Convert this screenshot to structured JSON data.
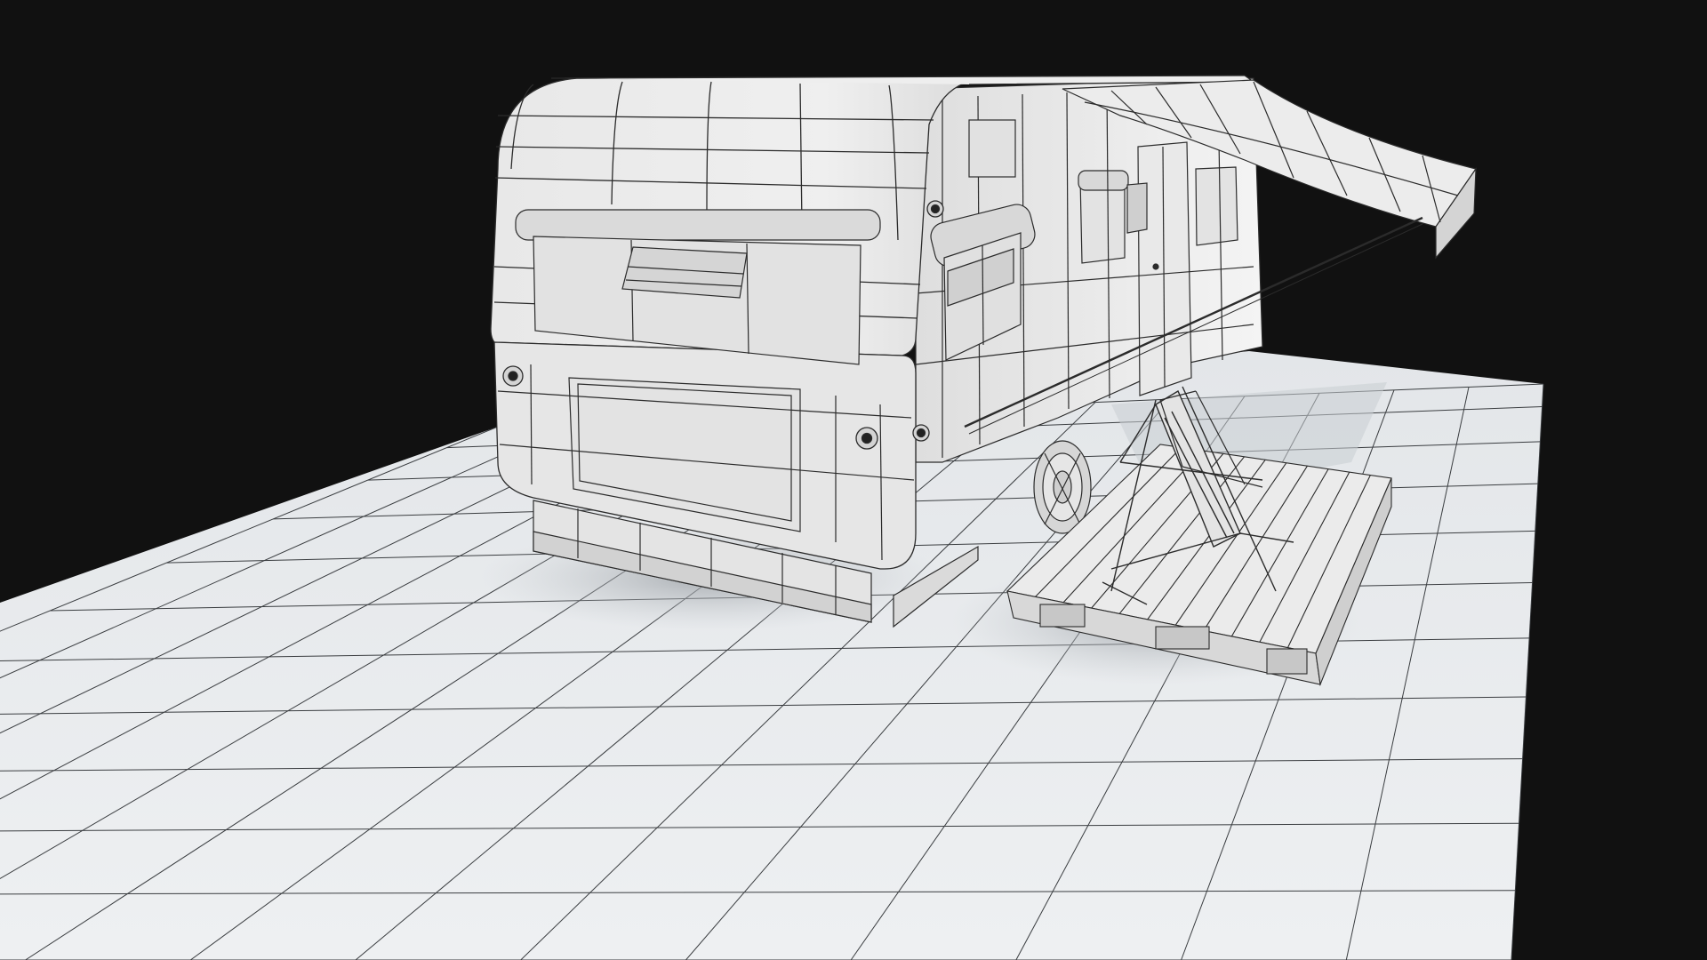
{
  "scene": {
    "background_color": "#111111",
    "floor_color": "#e6e9ec",
    "model_fill": "#ededed",
    "wire_color": "#2b2b2b",
    "shadow_color": "#b5b9bd",
    "objects": [
      "floor-grid",
      "caravan-trailer",
      "retractable-awning",
      "wooden-pallet-deck",
      "folding-deck-chair",
      "trailer-base-frame"
    ]
  }
}
